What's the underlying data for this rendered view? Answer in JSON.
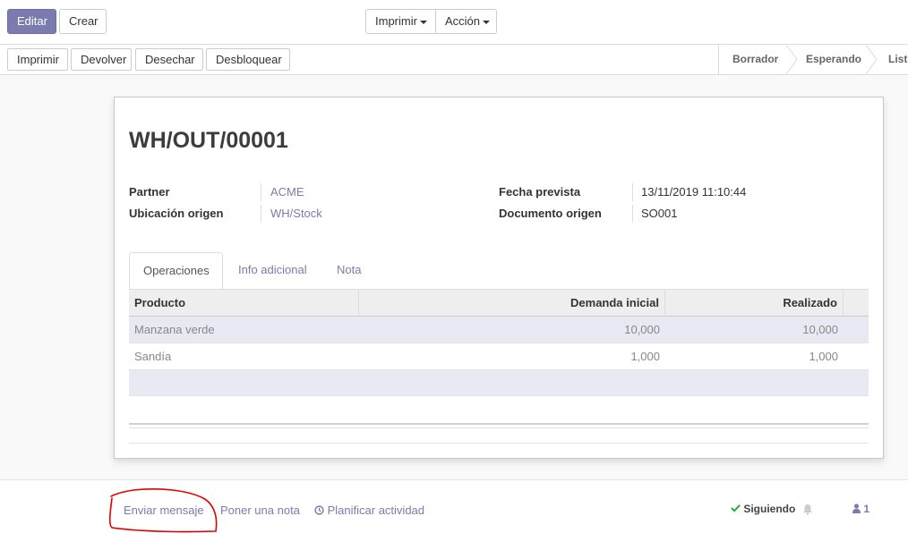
{
  "toolbar": {
    "edit_label": "Editar",
    "create_label": "Crear",
    "print_label": "Imprimir",
    "action_label": "Acción"
  },
  "statusbar": {
    "buttons": [
      "Imprimir",
      "Devolver",
      "Desechar",
      "Desbloquear"
    ],
    "stages": [
      "Borrador",
      "Esperando",
      "Listo"
    ]
  },
  "record": {
    "title": "WH/OUT/00001",
    "fields": {
      "partner_label": "Partner",
      "partner_value": "ACME",
      "location_label": "Ubicación origen",
      "location_value": "WH/Stock",
      "date_label": "Fecha prevista",
      "date_value": "13/11/2019 11:10:44",
      "origin_label": "Documento origen",
      "origin_value": "SO001"
    }
  },
  "tabs": [
    "Operaciones",
    "Info adicional",
    "Nota"
  ],
  "table": {
    "columns": [
      "Producto",
      "Demanda inicial",
      "Realizado"
    ],
    "rows": [
      {
        "product": "Manzana verde",
        "demand": "10,000",
        "done": "10,000"
      },
      {
        "product": "Sandía",
        "demand": "1,000",
        "done": "1,000"
      }
    ]
  },
  "chatter": {
    "send_message": "Enviar mensaje",
    "log_note": "Poner una nota",
    "schedule_activity": "Planificar actividad",
    "following": "Siguiendo",
    "followers_count": "1"
  },
  "colors": {
    "accent": "#7c7bad",
    "annotation": "#e00000"
  }
}
